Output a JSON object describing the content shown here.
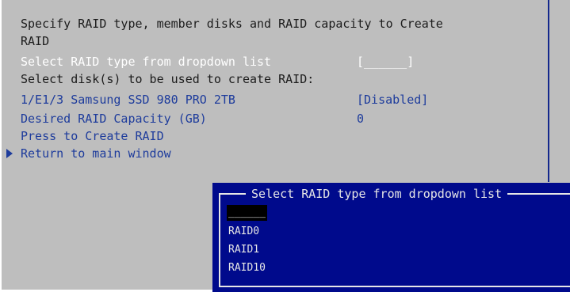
{
  "intro_line1": "Specify RAID type, member disks and RAID capacity to Create",
  "intro_line2": "RAID",
  "select_raid_label": "Select RAID type from dropdown list",
  "select_raid_value": "[______]",
  "select_disks_label": "Select disk(s) to be used to create RAID:",
  "disk_label": "1/E1/3 Samsung SSD 980 PRO 2TB",
  "disk_value": "[Disabled]",
  "capacity_label": "Desired RAID Capacity (GB)",
  "capacity_value": "0",
  "create_label": "Press to Create RAID",
  "return_label": "Return to main window",
  "dialog": {
    "title": "Select RAID type from dropdown list",
    "options": [
      "______",
      "RAID0",
      "RAID1",
      "RAID10"
    ],
    "selected_index": 0
  },
  "colors": {
    "background": "#bebebe",
    "link_blue": "#1e3c9c",
    "dialog_blue": "#000a8c"
  }
}
